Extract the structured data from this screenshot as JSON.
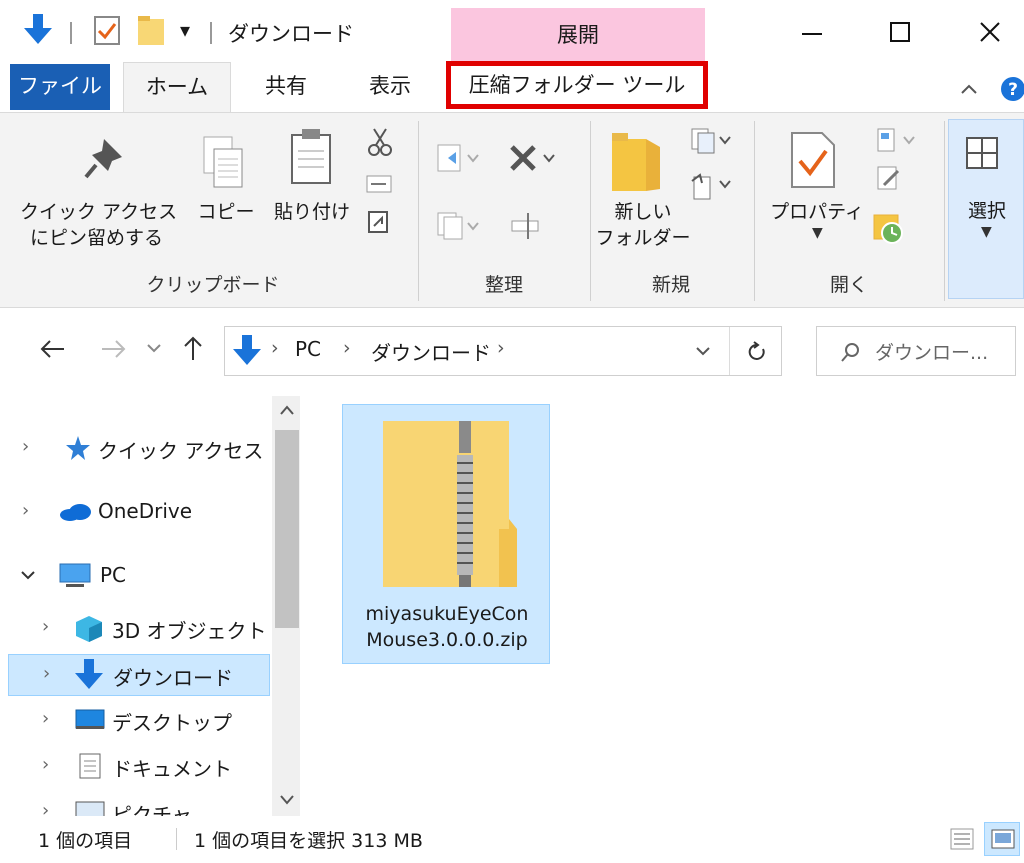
{
  "window": {
    "title": "ダウンロード",
    "context_tab_label": "展開",
    "qat_dropdown_glyph": "▾"
  },
  "ribbon_tabs": {
    "file": "ファイル",
    "home": "ホーム",
    "share": "共有",
    "view": "表示",
    "compressed_tools": "圧縮フォルダー ツール"
  },
  "ribbon": {
    "pin_label_line1": "クイック アクセス",
    "pin_label_line2": "にピン留めする",
    "copy_label": "コピー",
    "paste_label": "貼り付け",
    "new_folder_line1": "新しい",
    "new_folder_line2": "フォルダー",
    "properties_label": "プロパティ",
    "select_label": "選択",
    "group_clipboard": "クリップボード",
    "group_organize": "整理",
    "group_new": "新規",
    "group_open": "開く",
    "accent_blue": "#1a5fb4",
    "highlight_red": "#e00000"
  },
  "address": {
    "path": [
      "PC",
      "ダウンロード"
    ],
    "separator": "›",
    "search_placeholder": "ダウンロー..."
  },
  "nav_pane": {
    "items": [
      {
        "label": "クイック アクセス",
        "icon": "star-pin-icon",
        "expanded": false
      },
      {
        "label": "OneDrive",
        "icon": "cloud-icon",
        "expanded": false
      },
      {
        "label": "PC",
        "icon": "monitor-icon",
        "expanded": true
      },
      {
        "label": "3D オブジェクト",
        "icon": "cube-icon",
        "expanded": false
      },
      {
        "label": "ダウンロード",
        "icon": "download-arrow-icon",
        "expanded": false,
        "selected": true
      },
      {
        "label": "デスクトップ",
        "icon": "desktop-icon",
        "expanded": false
      },
      {
        "label": "ドキュメント",
        "icon": "document-icon",
        "expanded": false
      },
      {
        "label": "ピクチャ",
        "icon": "pictures-icon",
        "expanded": false
      }
    ]
  },
  "content": {
    "files": [
      {
        "name_line1": "miyasukuEyeCon",
        "name_line2": "Mouse3.0.0.0.zip",
        "icon": "zip-folder-icon",
        "selected": true
      }
    ]
  },
  "status": {
    "item_count": "1 個の項目",
    "selection": "1 個の項目を選択 313 MB"
  }
}
